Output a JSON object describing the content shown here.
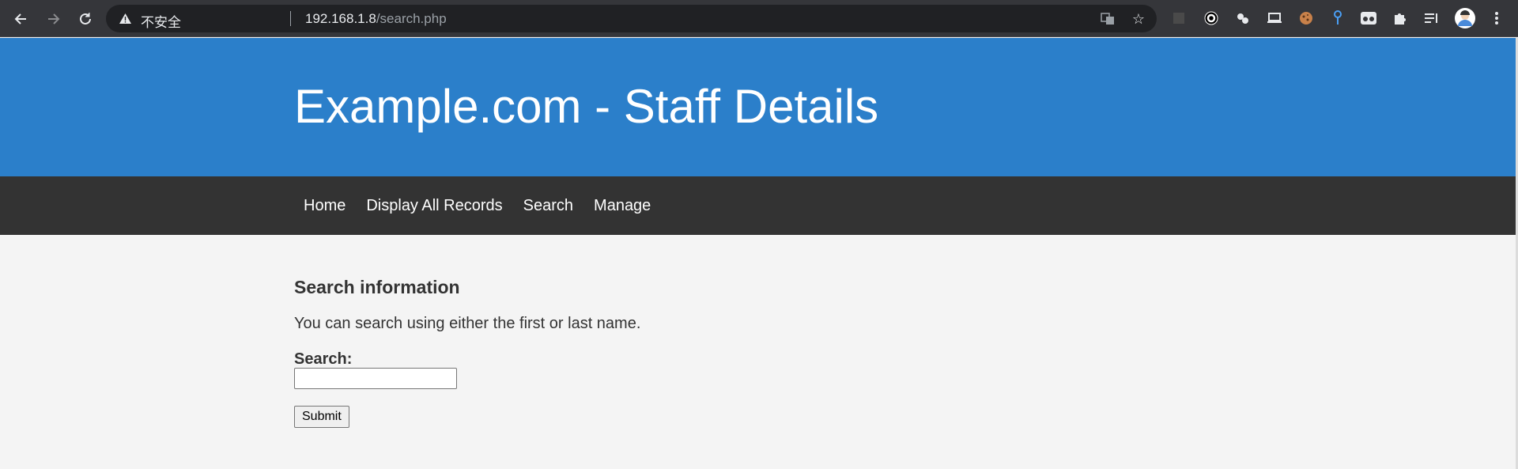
{
  "browser": {
    "back_icon": "arrow-left-icon",
    "forward_icon": "arrow-right-icon",
    "reload_icon": "reload-icon",
    "security_label": "不安全",
    "url_host": "192.168.1.8",
    "url_path": "/search.php",
    "extensions": [
      "translate-icon",
      "bookmark-star-icon",
      "extension-dark-square-icon",
      "extension-circle-icon",
      "extension-dots-icon",
      "extension-laptop-icon",
      "extension-cookie-icon",
      "extension-pin-icon",
      "extension-glasses-icon",
      "puzzle-icon",
      "reading-list-icon",
      "avatar",
      "menu-kebab-icon"
    ]
  },
  "site": {
    "title": "Example.com - Staff Details",
    "header_color": "#2b7fca",
    "nav_color": "#333333",
    "nav_items": [
      {
        "label": "Home"
      },
      {
        "label": "Display All Records"
      },
      {
        "label": "Search"
      },
      {
        "label": "Manage"
      }
    ]
  },
  "main": {
    "heading": "Search information",
    "description": "You can search using either the first or last name.",
    "search_label": "Search:",
    "search_value": "",
    "submit_label": "Submit"
  }
}
